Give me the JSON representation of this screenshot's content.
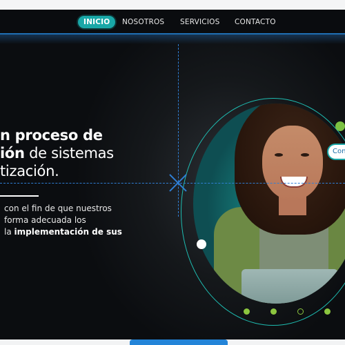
{
  "nav": {
    "items": [
      {
        "label": "INICIO",
        "active": true
      },
      {
        "label": "NOSOTROS",
        "active": false
      },
      {
        "label": "SERVICIOS",
        "active": false
      },
      {
        "label": "CONTACTO",
        "active": false
      }
    ]
  },
  "hero": {
    "headline_line1_bold": "n proceso de",
    "headline_line2_bold": "ión",
    "headline_line2_light": " de sistemas",
    "headline_line3_light": "tización.",
    "body_line1": "con el fin de que nuestros",
    "body_line2": "forma adecuada los",
    "body_line3_prefix": "la ",
    "body_line3_bold": "implementación de sus",
    "side_button_label": "Con"
  },
  "carousel": {
    "pages": 4,
    "active_index": 2
  },
  "colors": {
    "accent_teal": "#19a7a7",
    "guide_blue": "#2f7fd6",
    "pager_green": "#8cc63f"
  }
}
